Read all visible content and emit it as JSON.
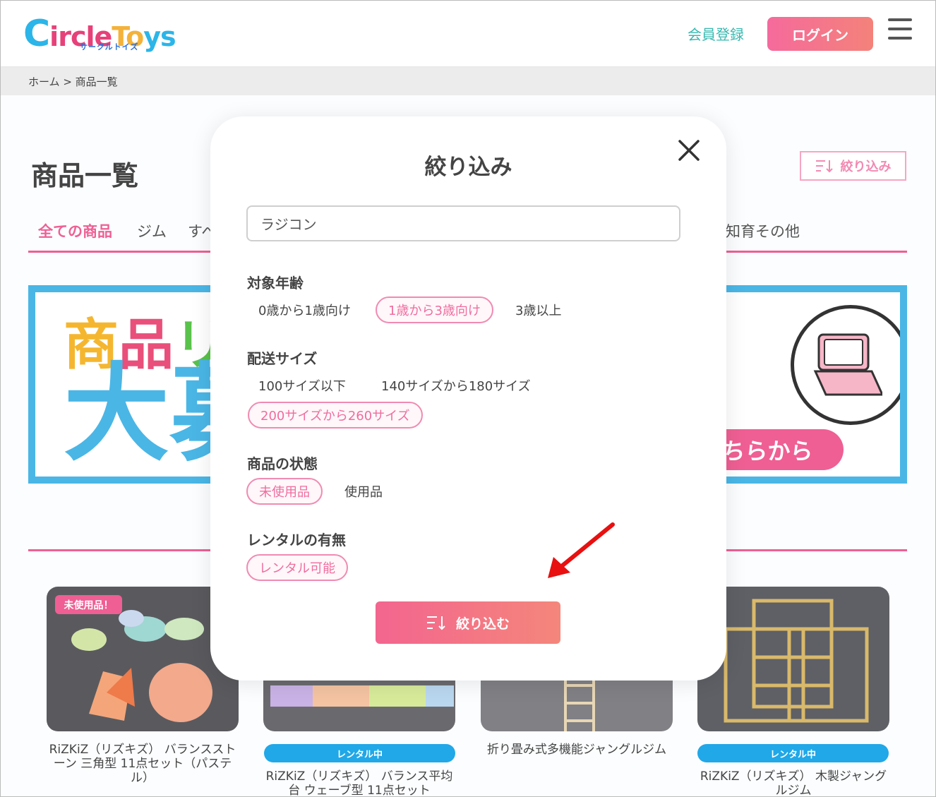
{
  "header": {
    "logo_text": "CircleToys",
    "logo_sub": "サークルトイズ",
    "register_label": "会員登録",
    "login_label": "ログイン"
  },
  "breadcrumb": "ホーム > 商品一覧",
  "page": {
    "title": "商品一覧",
    "filter_button_label": "絞り込み",
    "tabs": [
      "全ての商品",
      "ジム",
      "すべ",
      "知育その他"
    ],
    "banner": {
      "line1": "商品リ",
      "line2": "大募",
      "cta": "ちらから"
    }
  },
  "products": [
    {
      "title": "RiZKiZ（リズキズ） バランスストーン 三角型 11点セット（パステル）",
      "badge": "未使用品！"
    },
    {
      "title": "RiZKiZ（リズキズ） バランス平均台 ウェーブ型 11点セット",
      "rental_badge": "レンタル中"
    },
    {
      "title": "折り畳み式多機能ジャングルジム"
    },
    {
      "title": "RiZKiZ（リズキズ） 木製ジャングルジム",
      "rental_badge": "レンタル中"
    }
  ],
  "modal": {
    "title": "絞り込み",
    "search_value": "ラジコン",
    "sections": [
      {
        "label": "対象年齢",
        "options": [
          {
            "label": "0歳から1歳向け",
            "selected": false
          },
          {
            "label": "1歳から3歳向け",
            "selected": true
          },
          {
            "label": "3歳以上",
            "selected": false
          }
        ]
      },
      {
        "label": "配送サイズ",
        "options": [
          {
            "label": "100サイズ以下",
            "selected": false
          },
          {
            "label": "140サイズから180サイズ",
            "selected": false
          },
          {
            "label": "200サイズから260サイズ",
            "selected": true
          }
        ]
      },
      {
        "label": "商品の状態",
        "options": [
          {
            "label": "未使用品",
            "selected": true
          },
          {
            "label": "使用品",
            "selected": false
          }
        ]
      },
      {
        "label": "レンタルの有無",
        "options": [
          {
            "label": "レンタル可能",
            "selected": true
          }
        ]
      }
    ],
    "apply_label": "絞り込む"
  },
  "colors": {
    "accent": "#ef5f93",
    "brand_blue": "#4ab6e6",
    "register": "#38b8b0",
    "arrow": "#e81010"
  },
  "icons": [
    "close-icon",
    "filter-sort-icon",
    "hamburger-menu-icon",
    "red-arrow-annotation"
  ]
}
